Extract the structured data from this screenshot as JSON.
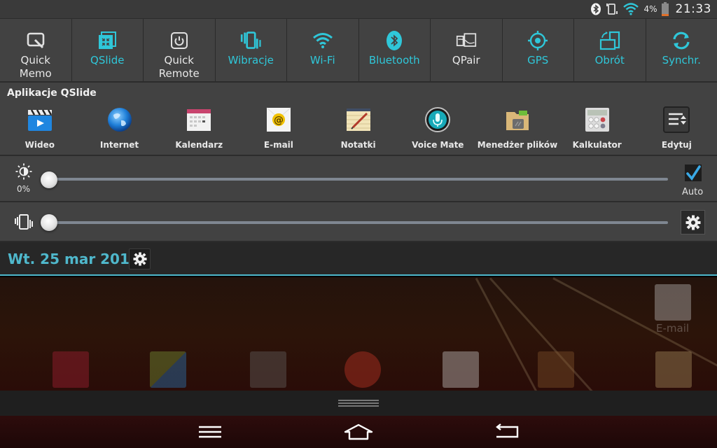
{
  "status_bar": {
    "icons": [
      "bluetooth-icon",
      "vibrate-mode-icon",
      "wifi-icon",
      "battery-icon"
    ],
    "battery_percent": "4%",
    "clock": "21:33",
    "colors": {
      "wifi": "#2fc7d9",
      "battery_low": "#e0702a"
    }
  },
  "quick_settings": [
    {
      "id": "quick-memo",
      "label": "Quick\nMemo",
      "icon": "quick-memo-icon",
      "active": false
    },
    {
      "id": "qslide",
      "label": "QSlide",
      "icon": "qslide-icon",
      "active": true
    },
    {
      "id": "quick-remote",
      "label": "Quick\nRemote",
      "icon": "power-remote-icon",
      "active": false
    },
    {
      "id": "wibracje",
      "label": "Wibracje",
      "icon": "vibrate-icon",
      "active": true
    },
    {
      "id": "wifi",
      "label": "Wi-Fi",
      "icon": "wifi-icon",
      "active": true
    },
    {
      "id": "bluetooth",
      "label": "Bluetooth",
      "icon": "bluetooth-icon",
      "active": true
    },
    {
      "id": "qpair",
      "label": "QPair",
      "icon": "qpair-icon",
      "active": false
    },
    {
      "id": "gps",
      "label": "GPS",
      "icon": "gps-icon",
      "active": true
    },
    {
      "id": "obrot",
      "label": "Obrót",
      "icon": "rotate-icon",
      "active": true
    },
    {
      "id": "synchr",
      "label": "Synchr.",
      "icon": "sync-icon",
      "active": true
    }
  ],
  "qslide_apps": {
    "title": "Aplikacje QSlide",
    "apps": [
      {
        "label": "Wideo",
        "icon": "video-clapper-icon"
      },
      {
        "label": "Internet",
        "icon": "globe-icon"
      },
      {
        "label": "Kalendarz",
        "icon": "calendar-icon"
      },
      {
        "label": "E-mail",
        "icon": "email-icon"
      },
      {
        "label": "Notatki",
        "icon": "notepad-icon"
      },
      {
        "label": "Voice Mate",
        "icon": "microphone-icon"
      },
      {
        "label": "Menedżer plików",
        "icon": "folder-icon"
      },
      {
        "label": "Kalkulator",
        "icon": "calculator-icon"
      },
      {
        "label": "Edytuj",
        "icon": "edit-list-icon"
      }
    ]
  },
  "brightness": {
    "percent_label": "0%",
    "value": 0,
    "auto_label": "Auto",
    "auto_checked": true
  },
  "vibration": {
    "value": 0
  },
  "date_bar": {
    "date": "Wt. 25 mar 2014"
  },
  "homescreen": {
    "email_label": "E-mail"
  },
  "accent_color": "#2fc7d9"
}
